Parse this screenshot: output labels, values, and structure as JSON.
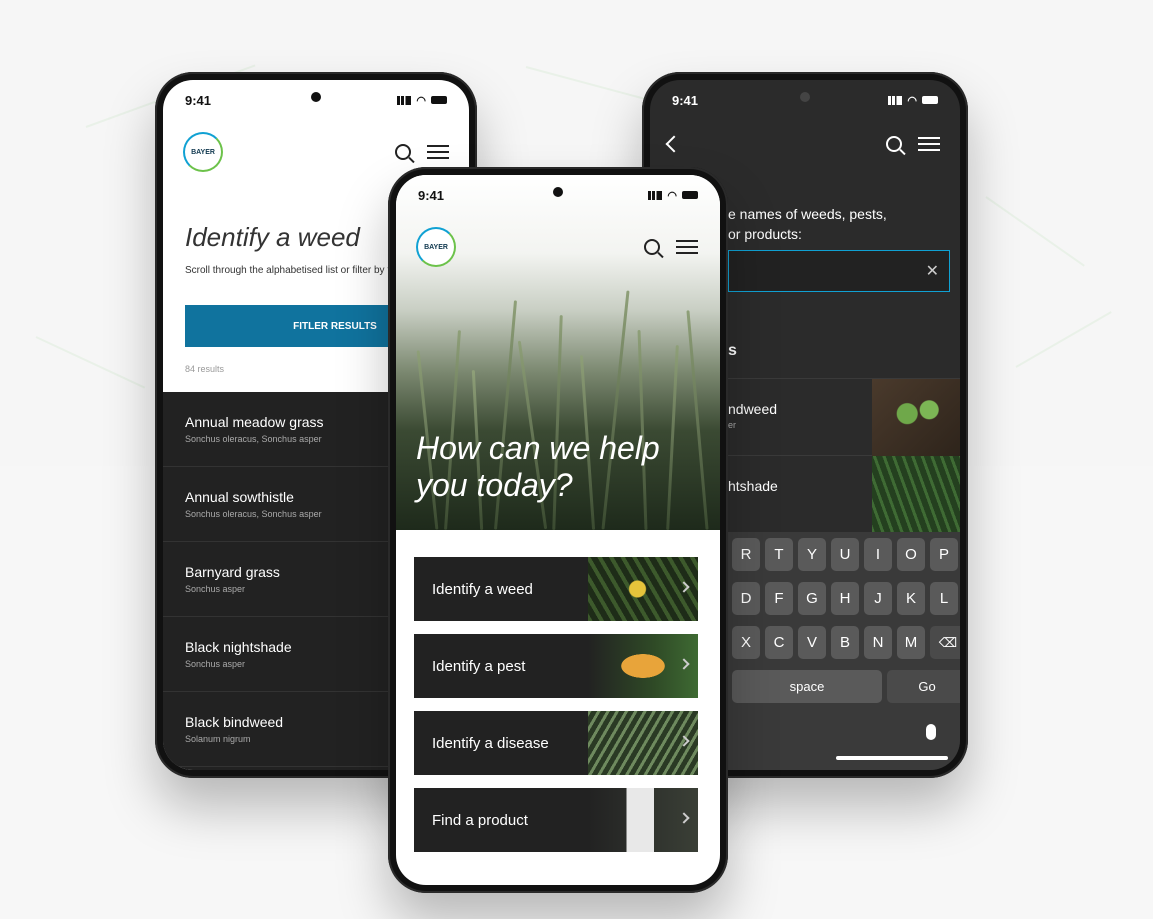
{
  "left_screen": {
    "time": "9:41",
    "logo_text": "BAYER",
    "title": "Identify a weed",
    "description": "Scroll through the alphabetised list or filter by type",
    "filter_button": "FITLER RESULTS",
    "result_count": "84 results",
    "items": [
      {
        "name": "Annual meadow grass",
        "latin": "Sonchus oleracus, Sonchus asper"
      },
      {
        "name": "Annual sowthistle",
        "latin": "Sonchus oleracus, Sonchus asper"
      },
      {
        "name": "Barnyard grass",
        "latin": "Sonchus asper"
      },
      {
        "name": "Black nightshade",
        "latin": "Sonchus asper"
      },
      {
        "name": "Black bindweed",
        "latin": "Solanum nigrum"
      }
    ]
  },
  "center_screen": {
    "time": "9:41",
    "logo_text": "BAYER",
    "heading": "How can we help you today?",
    "cards": [
      {
        "label": "Identify a weed"
      },
      {
        "label": "Identify a pest"
      },
      {
        "label": "Identify a disease"
      },
      {
        "label": "Find a product"
      }
    ]
  },
  "right_screen": {
    "time": "9:41",
    "prompt_line1": "e names of weeds, pests,",
    "prompt_line2": "or products:",
    "clear_symbol": "✕",
    "section_partial": "s",
    "results": [
      {
        "name": "ndweed",
        "sub": "er"
      },
      {
        "name": "htshade",
        "sub": ""
      }
    ],
    "keyboard": {
      "row1": [
        "R",
        "T",
        "Y",
        "U",
        "I",
        "O",
        "P"
      ],
      "row2": [
        "D",
        "F",
        "G",
        "H",
        "J",
        "K",
        "L"
      ],
      "row3": [
        "X",
        "C",
        "V",
        "B",
        "N",
        "M"
      ],
      "delete_symbol": "⌫",
      "space_label": "space",
      "go_label": "Go"
    }
  }
}
